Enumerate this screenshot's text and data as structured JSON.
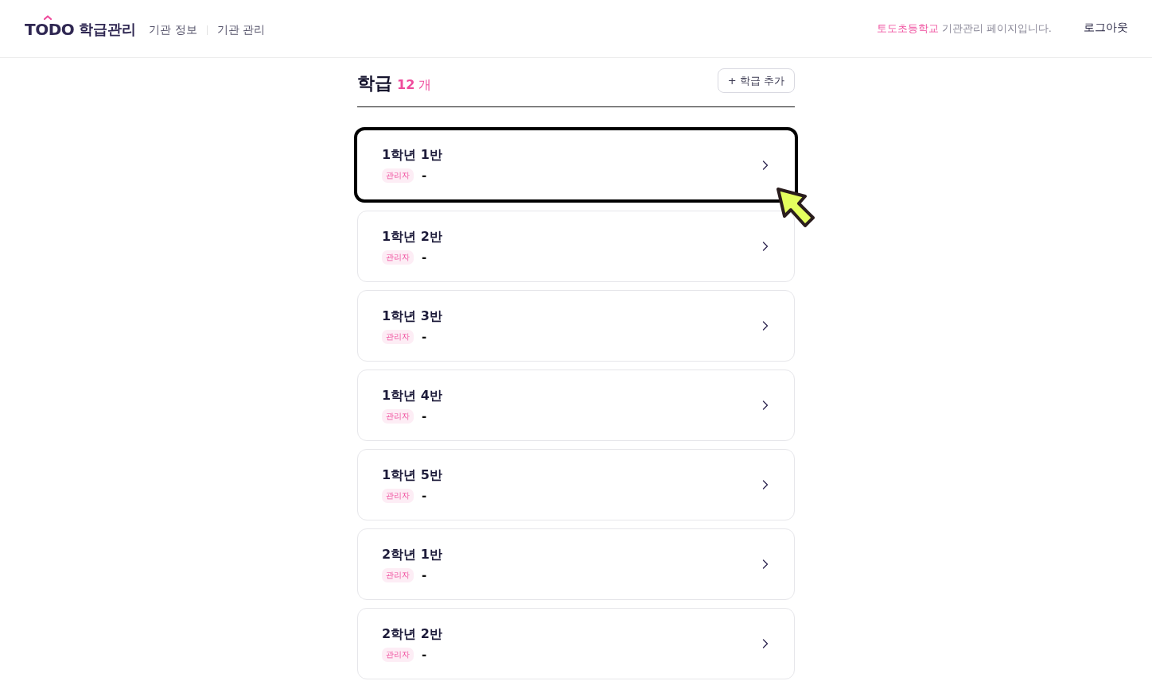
{
  "header": {
    "logo": {
      "brand": "TODO",
      "product": "학급관리"
    },
    "nav": [
      {
        "label": "기관 정보"
      },
      {
        "label": "기관 관리"
      }
    ],
    "notice": {
      "school": "토도초등학교",
      "text": "기관관리 페이지입니다."
    },
    "logout": "로그아웃"
  },
  "section": {
    "title": "학급",
    "count": "12",
    "count_unit": "개",
    "add_button": "+ 학급 추가"
  },
  "classes": [
    {
      "name": "1학년 1반",
      "role": "관리자",
      "manager": "-",
      "highlighted": true
    },
    {
      "name": "1학년 2반",
      "role": "관리자",
      "manager": "-",
      "highlighted": false
    },
    {
      "name": "1학년 3반",
      "role": "관리자",
      "manager": "-",
      "highlighted": false
    },
    {
      "name": "1학년 4반",
      "role": "관리자",
      "manager": "-",
      "highlighted": false
    },
    {
      "name": "1학년 5반",
      "role": "관리자",
      "manager": "-",
      "highlighted": false
    },
    {
      "name": "2학년 1반",
      "role": "관리자",
      "manager": "-",
      "highlighted": false
    },
    {
      "name": "2학년 2반",
      "role": "관리자",
      "manager": "-",
      "highlighted": false
    }
  ]
}
